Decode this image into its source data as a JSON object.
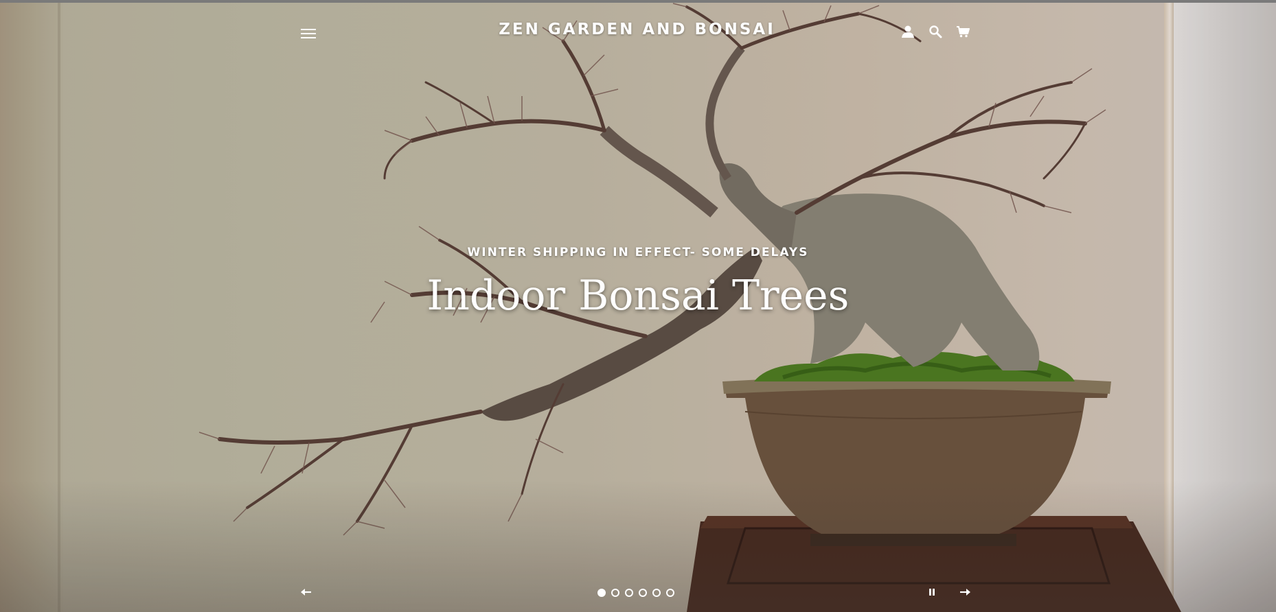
{
  "header": {
    "site_title": "ZEN GARDEN AND BONSAI",
    "icons": {
      "menu": "hamburger-menu-icon",
      "account": "user-icon",
      "search": "search-icon",
      "cart": "cart-icon"
    }
  },
  "hero": {
    "subtitle": "WINTER SHIPPING IN EFFECT- SOME DELAYS",
    "heading": "Indoor Bonsai Trees",
    "image": "bonsai-tree-in-pot"
  },
  "slideshow": {
    "slide_count": 6,
    "active_slide": 1,
    "icons": {
      "previous": "arrow-left-icon",
      "pause": "pause-icon",
      "next": "arrow-right-icon"
    }
  },
  "colors": {
    "text": "#ffffff",
    "background_tone": "#c2b9a6",
    "pot": "#6e5540",
    "stand": "#4a2a1f",
    "moss": "#4f7d23"
  }
}
